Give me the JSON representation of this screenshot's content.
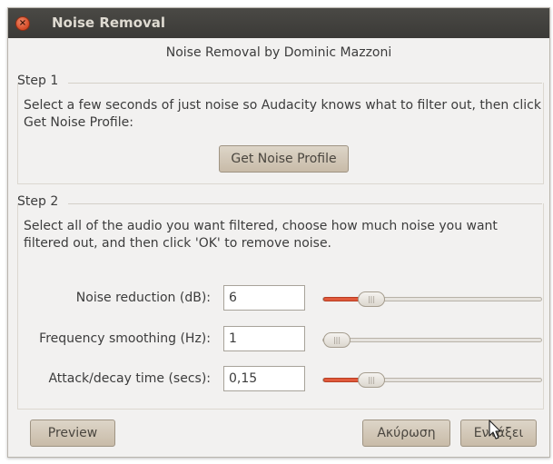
{
  "window": {
    "title": "Noise Removal",
    "subtitle": "Noise Removal by Dominic Mazzoni"
  },
  "step1": {
    "label": "Step 1",
    "text": "Select a few seconds of just noise so Audacity knows what to filter out, then click Get Noise Profile:",
    "button_label": "Get Noise Profile"
  },
  "step2": {
    "label": "Step 2",
    "text": "Select all of the audio you want filtered, choose how much noise you want filtered out, and then click 'OK' to remove noise.",
    "fields": [
      {
        "label": "Noise reduction (dB):",
        "value": "6",
        "slider_fraction": 0.18
      },
      {
        "label": "Frequency smoothing (Hz):",
        "value": "1",
        "slider_fraction": 0.0
      },
      {
        "label": "Attack/decay time (secs):",
        "value": "0,15",
        "slider_fraction": 0.18
      }
    ]
  },
  "buttons": {
    "preview": "Preview",
    "cancel": "Ακύρωση",
    "ok": "Εντάξει"
  },
  "colors": {
    "titlebar": "#3c3b37",
    "slider_fill": "#e05a3c",
    "button_bg": "#d4cabb"
  }
}
